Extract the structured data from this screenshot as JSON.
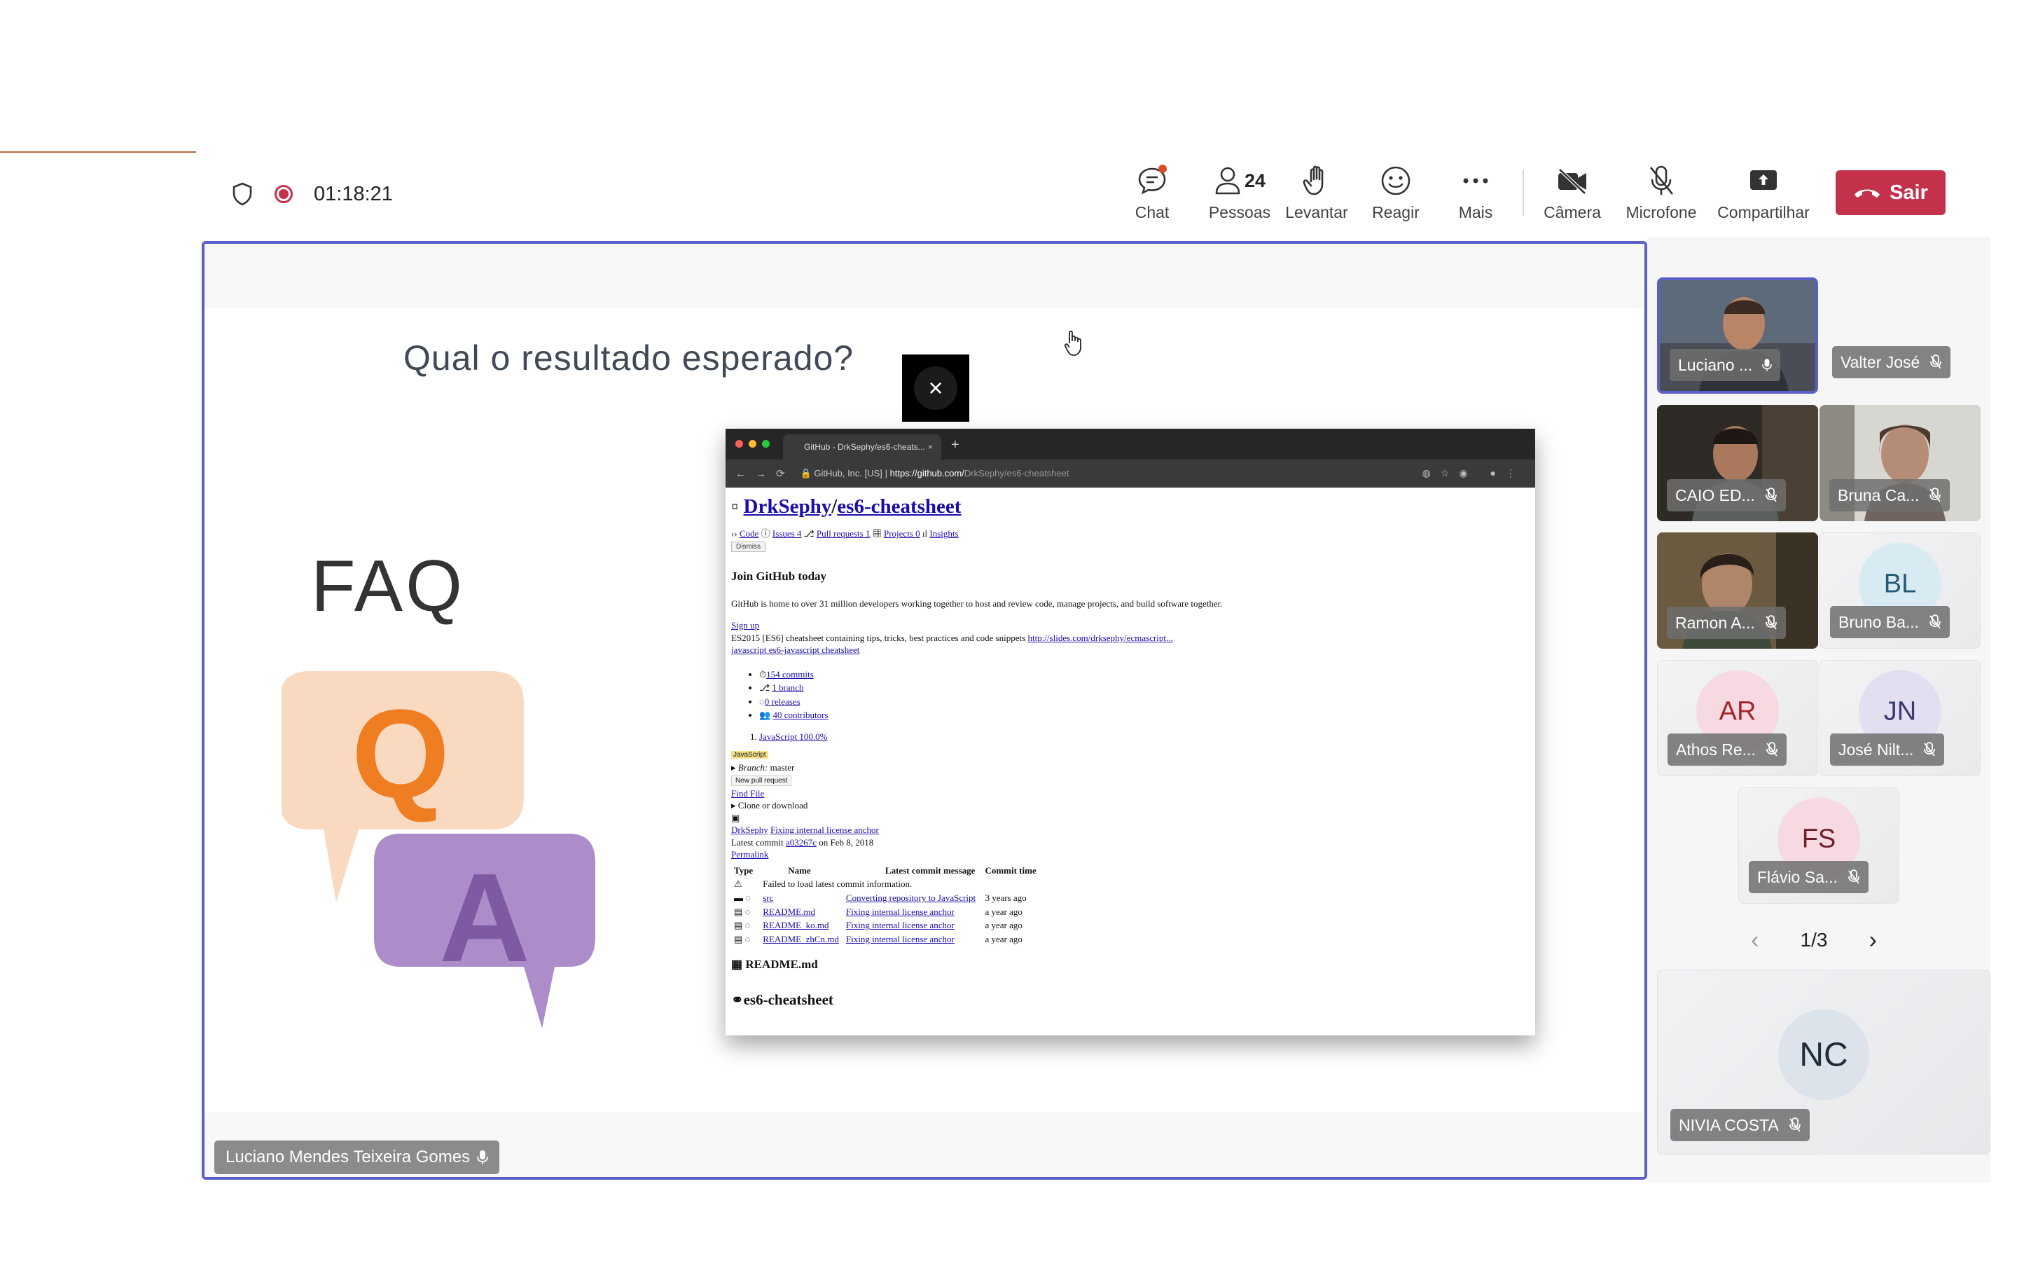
{
  "toolbar": {
    "timer": "01:18:21",
    "buttons": {
      "chat": "Chat",
      "people": "Pessoas",
      "people_count": "24",
      "raise": "Levantar",
      "react": "Reagir",
      "more": "Mais",
      "camera": "Câmera",
      "mic": "Microfone",
      "share": "Compartilhar"
    },
    "leave": "Sair",
    "leave_color": "#c4314b"
  },
  "stage": {
    "presenter": "Luciano Mendes Teixeira Gomes",
    "slide": {
      "title": "Qual o resultado esperado?",
      "faq": "FAQ",
      "q": "Q",
      "a": "A"
    },
    "close_symbol": "×"
  },
  "browser": {
    "tab_title": "GitHub - DrkSephy/es6-cheats...",
    "tab_close": "×",
    "new_tab": "+",
    "url_prefix": "GitHub, Inc. [US]",
    "url_separator": "|",
    "url_host": "https://github.com/",
    "url_path": "DrkSephy/es6-cheatsheet",
    "owner": "DrkSephy",
    "repo": "es6-cheatsheet",
    "tabs": [
      "Code",
      "Issues 4",
      "Pull requests 1",
      "Projects 0",
      "Insights"
    ],
    "dismiss": "Dismiss",
    "join_title": "Join GitHub today",
    "join_text": "GitHub is home to over 31 million developers working together to host and review code, manage projects, and build software together.",
    "signup": "Sign up",
    "description": "ES2015 [ES6] cheatsheet containing tips, tricks, best practices and code snippets",
    "slides_link": "http://slides.com/drksephy/ecmascript...",
    "topics": "javascript es6-javascript cheatsheet",
    "stats": [
      "154 commits",
      "1 branch",
      "0 releases",
      "40 contributors"
    ],
    "language": "JavaScript 100.0%",
    "lang_badge": "JavaScript",
    "branch_label": "Branch:",
    "branch": "master",
    "new_pr": "New pull request",
    "find_file": "Find File",
    "clone": "Clone or download",
    "commit_author": "DrkSephy",
    "commit_msg": "Fixing internal license anchor",
    "latest_commit_prefix": "Latest commit",
    "latest_commit_hash": "a03267c",
    "latest_commit_date": "on Feb 8, 2018",
    "permalink": "Permalink",
    "columns": [
      "Type",
      "Name",
      "Latest commit message",
      "Commit time"
    ],
    "load_error": "Failed to load latest commit information.",
    "files": [
      {
        "name": "src",
        "msg": "Converting repository to JavaScript",
        "time": "3 years ago"
      },
      {
        "name": "README.md",
        "msg": "Fixing internal license anchor",
        "time": "a year ago"
      },
      {
        "name": "README_ko.md",
        "msg": "Fixing internal license anchor",
        "time": "a year ago"
      },
      {
        "name": "README_zhCn.md",
        "msg": "Fixing internal license anchor",
        "time": "a year ago"
      }
    ],
    "readme_heading": "README.md",
    "readme_title": "es6-cheatsheet"
  },
  "participants": [
    {
      "name": "Luciano ...",
      "type": "camera",
      "mic": "on",
      "selected": true
    },
    {
      "name": "Valter José",
      "type": "none",
      "mic": "muted"
    },
    {
      "name": "CAIO ED...",
      "type": "camera",
      "mic": "muted"
    },
    {
      "name": "Bruna Ca...",
      "type": "camera",
      "mic": "muted"
    },
    {
      "name": "Ramon A...",
      "type": "camera",
      "mic": "muted"
    },
    {
      "name": "Bruno Ba...",
      "initials": "BL",
      "type": "avatar",
      "mic": "muted",
      "bg": "#d9ebf2",
      "fg": "#255a74"
    },
    {
      "name": "Athos Re...",
      "initials": "AR",
      "type": "avatar",
      "mic": "muted",
      "bg": "#f6d9e1",
      "fg": "#a4262c"
    },
    {
      "name": "José Nilt...",
      "initials": "JN",
      "type": "avatar",
      "mic": "muted",
      "bg": "#e3dff0",
      "fg": "#3b3a6e"
    },
    {
      "name": "Flávio Sa...",
      "initials": "FS",
      "type": "avatar",
      "mic": "muted",
      "bg": "#f6d9e1",
      "fg": "#6e1f2a"
    }
  ],
  "pager": {
    "label": "1/3",
    "prev": "‹",
    "next": "›"
  },
  "featured": {
    "name": "NIVIA COSTA",
    "initials": "NC",
    "mic": "muted"
  }
}
